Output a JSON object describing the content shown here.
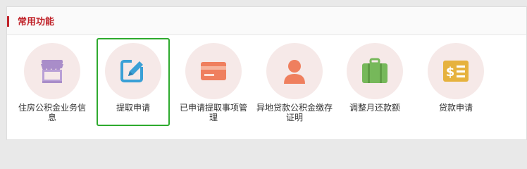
{
  "panel": {
    "title": "常用功能",
    "accent_color": "#c0232a",
    "title_color": "#c0232a"
  },
  "tiles": [
    {
      "label": "住房公积金业务信息",
      "icon": "house-awning-icon",
      "icon_color": "#a98dc9"
    },
    {
      "label": "提取申请",
      "icon": "edit-document-icon",
      "icon_color": "#3aa0d6",
      "selected": true
    },
    {
      "label": "已申请提取事项管理",
      "icon": "card-icon",
      "icon_color": "#ef7f5e"
    },
    {
      "label": "异地贷款公积金缴存证明",
      "icon": "person-icon",
      "icon_color": "#ef7f5e"
    },
    {
      "label": "调整月还款额",
      "icon": "briefcase-icon",
      "icon_color": "#76b85a"
    },
    {
      "label": "贷款申请",
      "icon": "loan-document-icon",
      "icon_color": "#e6b23e"
    }
  ],
  "colors": {
    "circle_bg": "#f6e9e8",
    "selected_border": "#2eaa2e"
  }
}
